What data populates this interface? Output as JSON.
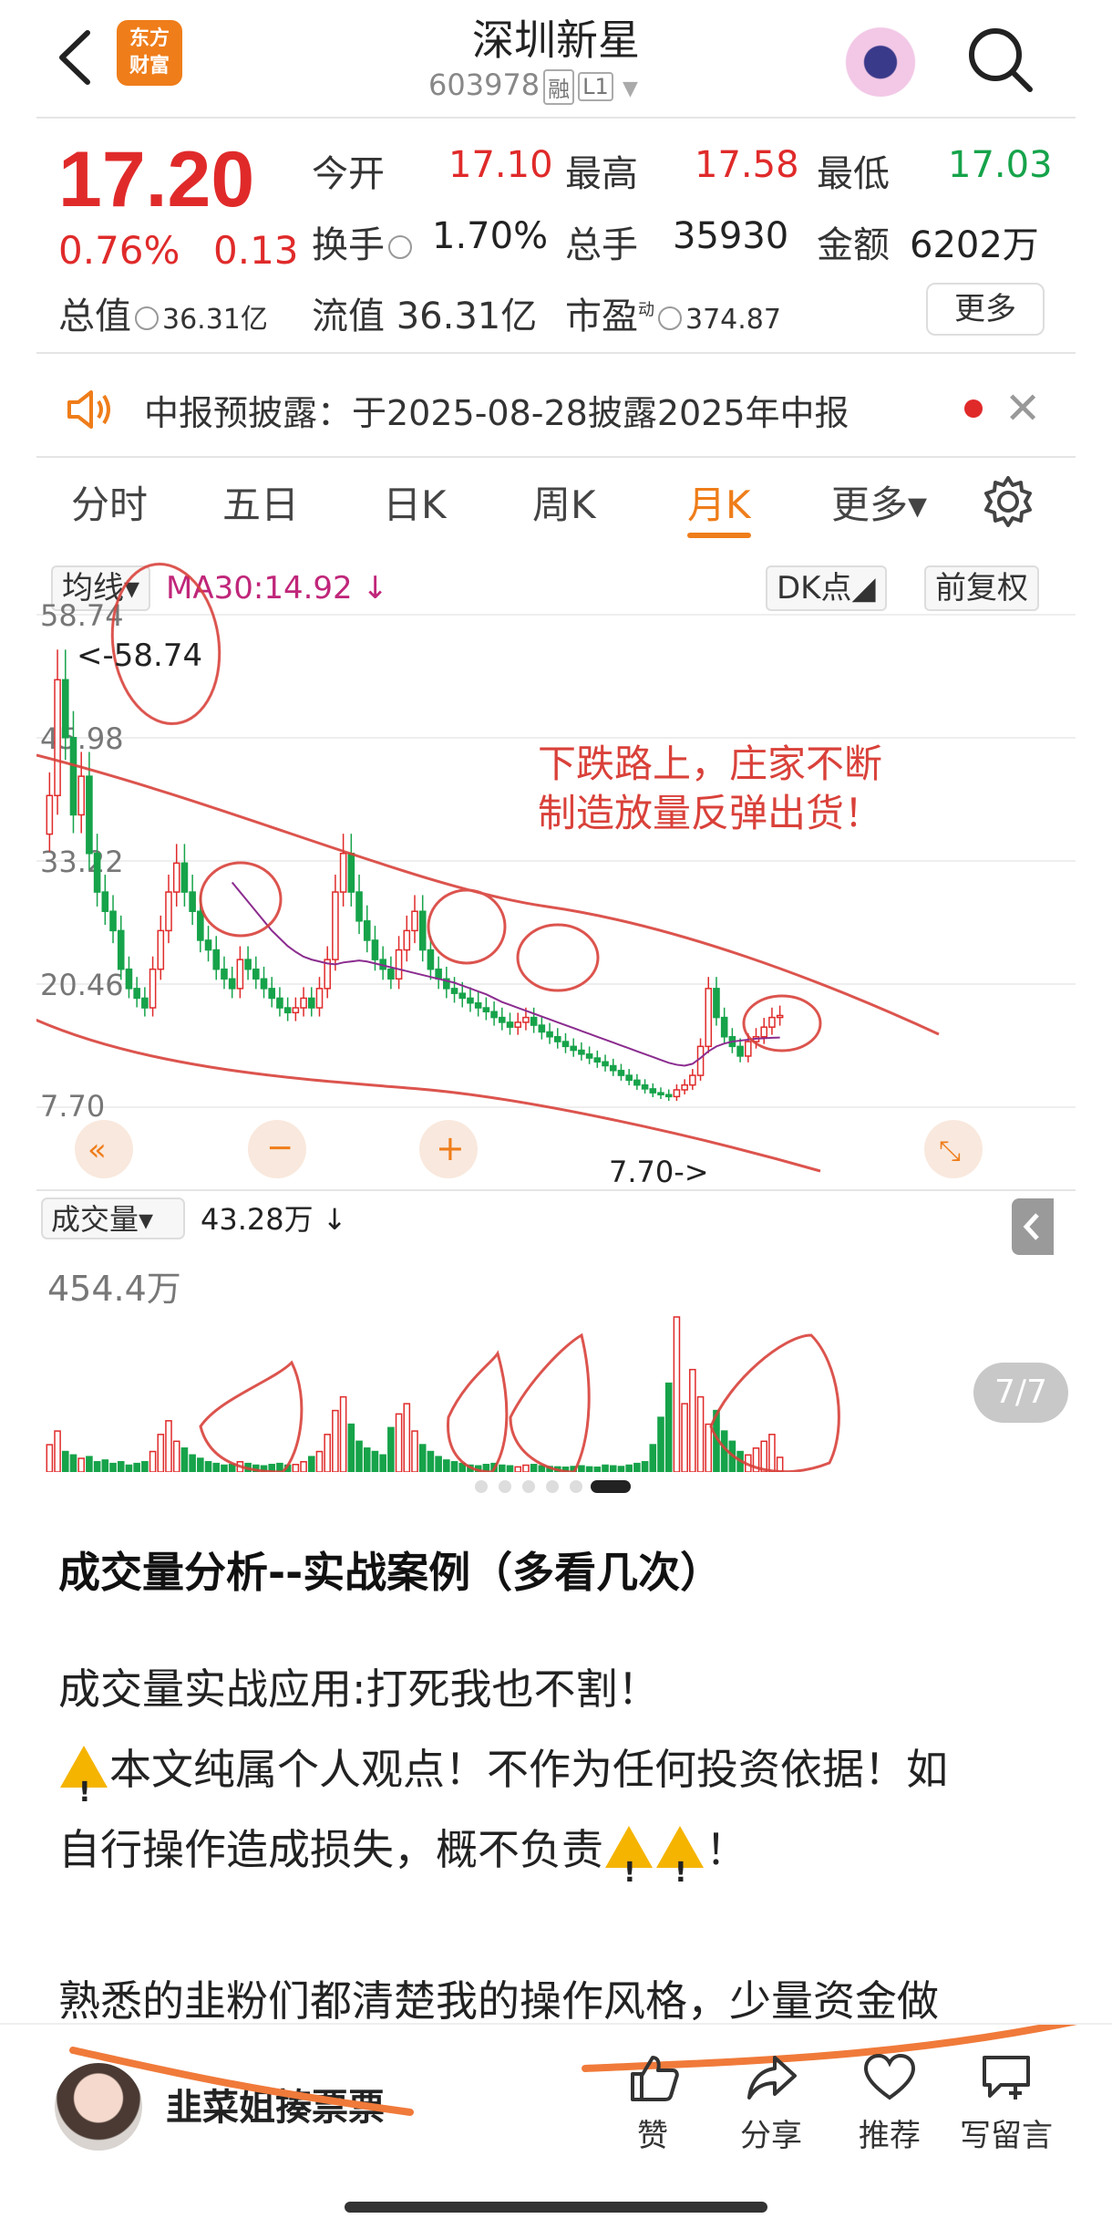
{
  "header": {
    "logo_line1": "东方",
    "logo_line2": "财富",
    "stock_name": "深圳新星",
    "stock_code": "603978",
    "tag_margin": "融",
    "tag_level": "L1"
  },
  "quote": {
    "price": "17.20",
    "change_pct": "0.76%",
    "change_abs": "0.13",
    "open_label": "今开",
    "open": "17.10",
    "high_label": "最高",
    "high": "17.58",
    "low_label": "最低",
    "low": "17.03",
    "turnover_label": "换手",
    "turnover": "1.70%",
    "volume_label": "总手",
    "volume": "35930",
    "amount_label": "金额",
    "amount": "6202万",
    "mcap_label": "总值",
    "mcap": "36.31亿",
    "float_label": "流值",
    "float": "36.31亿",
    "pe_label": "市盈",
    "pe_sup": "动",
    "pe": "374.87",
    "more_label": "更多"
  },
  "notice": {
    "text": "中报预披露：于2025-08-28披露2025年中报"
  },
  "tabs": [
    {
      "label": "分时"
    },
    {
      "label": "五日"
    },
    {
      "label": "日K"
    },
    {
      "label": "周K"
    },
    {
      "label": "月K"
    },
    {
      "label": "更多▾"
    }
  ],
  "chart_controls": {
    "ma_label": "均线▾",
    "ma_value": "MA30:14.92 ↓",
    "dk_label": "DK点◢",
    "adjust_label": "前复权",
    "vol_label": "成交量▾",
    "vol_value": "43.28万 ↓",
    "vol_max": "454.4万"
  },
  "chart_data": {
    "type": "candlestick",
    "price_ticks": [
      "58.74",
      "45.98",
      "33.22",
      "20.46",
      "7.70"
    ],
    "ylim": [
      7.7,
      58.74
    ],
    "max_marker": "<-58.74",
    "min_marker": "7.70->",
    "ma30_label": "MA30:14.92",
    "annotation": "下跌路上，庄家不断\n制造放量反弹出货！",
    "close_series": [
      40,
      52,
      46,
      38,
      42,
      34,
      30,
      28,
      26,
      22,
      20,
      19,
      18,
      22,
      26,
      30,
      33,
      30,
      28,
      25,
      24,
      22,
      21,
      20,
      23,
      22,
      21,
      20,
      19,
      18,
      17.5,
      18,
      19,
      18,
      20,
      23,
      30,
      34,
      30,
      27,
      25,
      23,
      22,
      21,
      24,
      26,
      28,
      24,
      22,
      21,
      20,
      19.5,
      19,
      18.5,
      18,
      17.6,
      17,
      16.5,
      16,
      16.5,
      17,
      16.2,
      15.5,
      15,
      14.5,
      14,
      13.6,
      13.2,
      12.8,
      12.4,
      12,
      11.5,
      11,
      10.5,
      10,
      9.6,
      9.2,
      9,
      8.8,
      9.5,
      10,
      11,
      14,
      20,
      17,
      15,
      14,
      13,
      14.5,
      15,
      16,
      17,
      17.2
    ],
    "ma30_series": [
      null,
      null,
      null,
      null,
      null,
      null,
      null,
      null,
      null,
      null,
      null,
      null,
      null,
      null,
      null,
      null,
      null,
      null,
      null,
      null,
      null,
      null,
      null,
      31,
      30,
      29,
      28,
      27,
      26,
      25.2,
      24.4,
      23.8,
      23.3,
      23,
      22.8,
      22.6,
      22.5,
      22.7,
      22.8,
      22.9,
      22.8,
      22.6,
      22.4,
      22.2,
      22,
      21.8,
      21.6,
      21.4,
      21.2,
      21,
      20.8,
      20.6,
      20.3,
      20,
      19.7,
      19.4,
      19,
      18.6,
      18.3,
      18,
      17.7,
      17.4,
      17.1,
      16.8,
      16.5,
      16.2,
      15.9,
      15.6,
      15.3,
      15,
      14.7,
      14.4,
      14.1,
      13.8,
      13.5,
      13.2,
      12.9,
      12.6,
      12.3,
      12.1,
      12,
      12.2,
      12.8,
      13.5,
      14,
      14.3,
      14.5,
      14.6,
      14.7,
      14.8,
      14.85,
      14.9,
      14.92
    ],
    "volume_series": [
      80,
      120,
      60,
      50,
      40,
      45,
      30,
      35,
      25,
      30,
      20,
      25,
      30,
      60,
      110,
      150,
      90,
      70,
      50,
      40,
      30,
      25,
      20,
      22,
      30,
      25,
      20,
      18,
      22,
      25,
      20,
      22,
      30,
      45,
      60,
      110,
      180,
      220,
      140,
      90,
      70,
      60,
      50,
      130,
      170,
      200,
      120,
      80,
      60,
      45,
      35,
      30,
      25,
      20,
      18,
      22,
      25,
      20,
      18,
      15,
      20,
      22,
      18,
      16,
      15,
      14,
      16,
      18,
      15,
      14,
      20,
      18,
      16,
      20,
      25,
      30,
      80,
      160,
      260,
      454,
      200,
      300,
      220,
      140,
      180,
      120,
      90,
      60,
      50,
      70,
      90,
      110,
      43
    ]
  },
  "article": {
    "title": "成交量分析--实战案例（多看几次）",
    "line1": "成交量实战应用:打死我也不割！",
    "line2a": "本文纯属个人观点！不作为任何投资依据！如",
    "line2b": "自行操作造成损失，概不负责",
    "line2b_end": "！",
    "line3": "熟悉的韭粉们都清楚我的操作风格，少量资金做"
  },
  "image_counter": "7/7",
  "bottom": {
    "author": "韭菜姐揍票票",
    "like": "赞",
    "share": "分享",
    "recommend": "推荐",
    "comment": "写留言"
  },
  "colors": {
    "up": "#e02a2a",
    "down": "#16a34a",
    "accent": "#ef7d1a",
    "ma30": "#8b2c8f",
    "annotation_ink": "#d9413a"
  }
}
